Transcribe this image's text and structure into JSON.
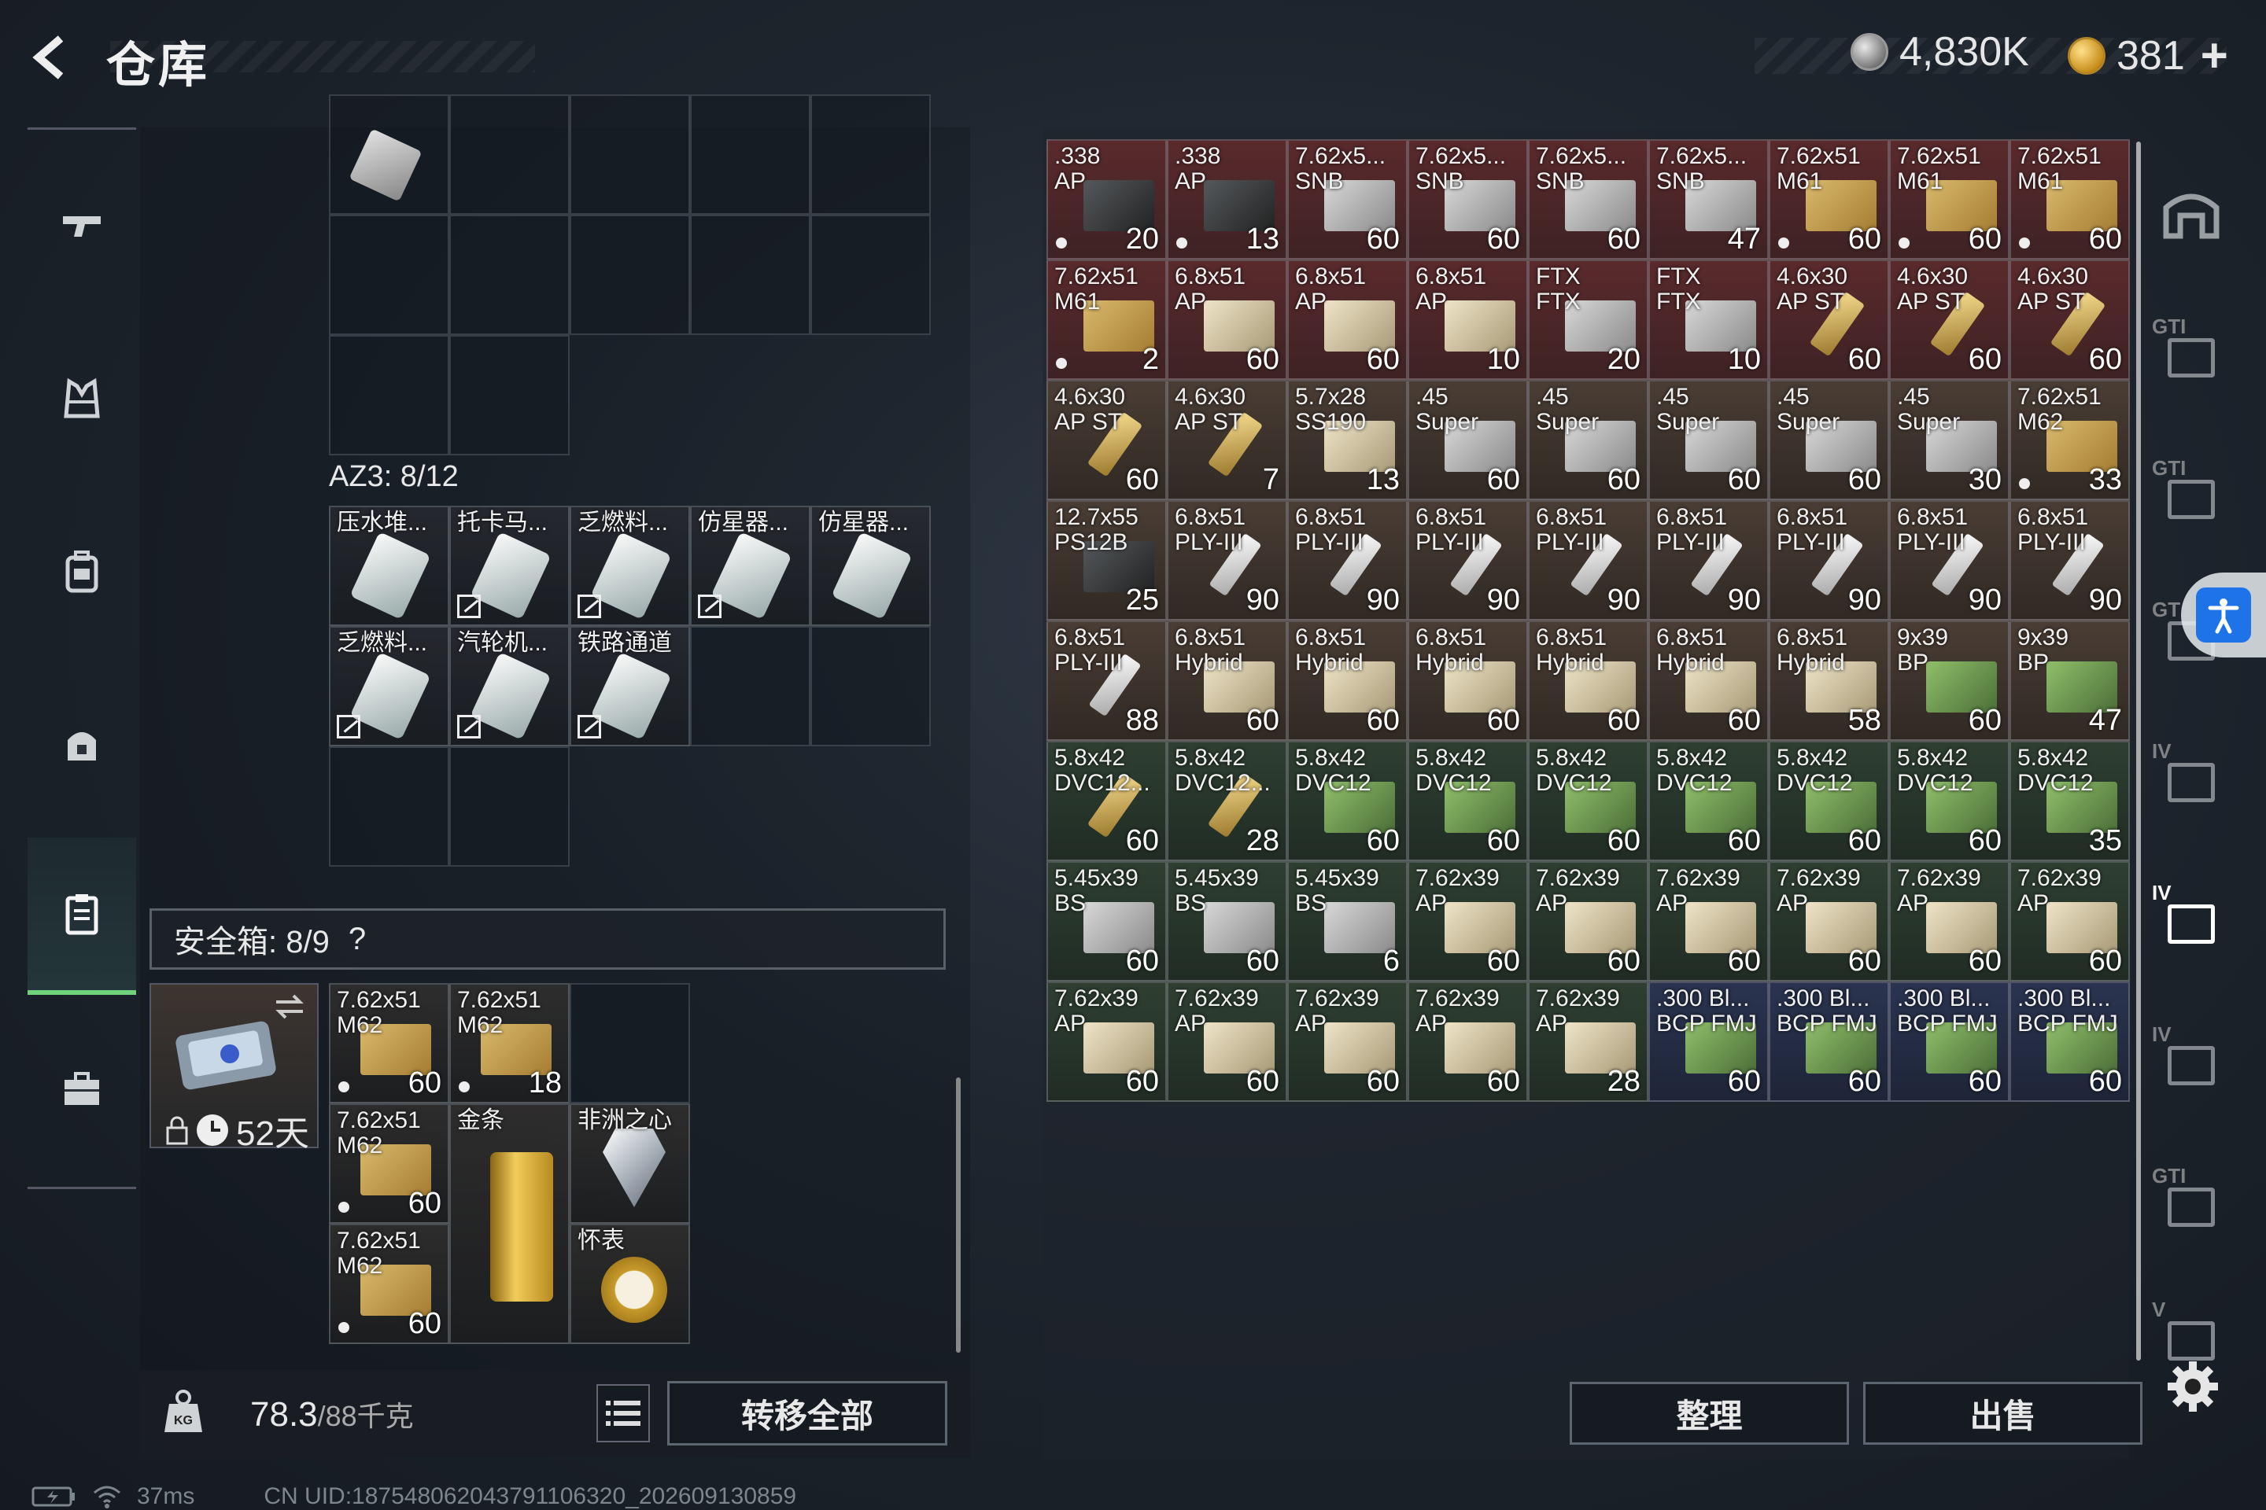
{
  "header": {
    "title": "仓库",
    "currency_silver": "4,830K",
    "currency_gold": "381",
    "plus": "+"
  },
  "az3": {
    "label": "AZ3: 8/12"
  },
  "az3_items": [
    {
      "label": "压水堆...",
      "flag": false
    },
    {
      "label": "托卡马...",
      "flag": true
    },
    {
      "label": "乏燃料...",
      "flag": true
    },
    {
      "label": "仿星器...",
      "flag": true
    },
    {
      "label": "仿星器...",
      "flag": false
    },
    {
      "label": "乏燃料...",
      "flag": true
    },
    {
      "label": "汽轮机...",
      "flag": true
    },
    {
      "label": "铁路通道",
      "flag": true
    }
  ],
  "safe": {
    "label": "安全箱: 8/9",
    "help": "?",
    "days": "52天"
  },
  "safe_items": [
    {
      "l1": "7.62x51",
      "l2": "M62",
      "count": "60"
    },
    {
      "l1": "7.62x51",
      "l2": "M62",
      "count": "18"
    },
    {
      "l1": "7.62x51",
      "l2": "M62",
      "count": "60"
    },
    {
      "l1": "金条",
      "l2": "",
      "count": ""
    },
    {
      "l1": "非洲之心",
      "l2": "",
      "count": ""
    },
    {
      "l1": "7.62x51",
      "l2": "M62",
      "count": "60"
    },
    {
      "l1": "怀表",
      "l2": "",
      "count": ""
    }
  ],
  "bottom": {
    "weight": "78.3",
    "weight_max": "/88千克",
    "transfer_all": "转移全部",
    "sort": "整理",
    "sell": "出售"
  },
  "status": {
    "ping": "37ms",
    "uid": "CN UID:1875480620437911063​20_202609130859"
  },
  "right_sidebar": [
    "GTI",
    "GTI",
    "GT",
    "IV",
    "IV",
    "IV",
    "GTI",
    "V"
  ],
  "ammo": [
    {
      "l1": ".338",
      "l2": "AP",
      "count": "20",
      "c": "red",
      "s": "sp-dark",
      "dot": true
    },
    {
      "l1": ".338",
      "l2": "AP",
      "count": "13",
      "c": "red",
      "s": "sp-dark",
      "dot": true
    },
    {
      "l1": "7.62x5...",
      "l2": "SNB",
      "count": "60",
      "c": "red",
      "s": "sp-silver",
      "dot": false
    },
    {
      "l1": "7.62x5...",
      "l2": "SNB",
      "count": "60",
      "c": "red",
      "s": "sp-silver",
      "dot": false
    },
    {
      "l1": "7.62x5...",
      "l2": "SNB",
      "count": "60",
      "c": "red",
      "s": "sp-silver",
      "dot": false
    },
    {
      "l1": "7.62x5...",
      "l2": "SNB",
      "count": "47",
      "c": "red",
      "s": "sp-silver",
      "dot": false
    },
    {
      "l1": "7.62x51",
      "l2": "M61",
      "count": "60",
      "c": "red",
      "s": "sp-box",
      "dot": true
    },
    {
      "l1": "7.62x51",
      "l2": "M61",
      "count": "60",
      "c": "red",
      "s": "sp-box",
      "dot": true
    },
    {
      "l1": "7.62x51",
      "l2": "M61",
      "count": "60",
      "c": "red",
      "s": "sp-box",
      "dot": true
    },
    {
      "l1": "7.62x51",
      "l2": "M61",
      "count": "2",
      "c": "red",
      "s": "sp-box",
      "dot": true
    },
    {
      "l1": "6.8x51",
      "l2": "AP",
      "count": "60",
      "c": "red",
      "s": "sp-cream",
      "dot": false
    },
    {
      "l1": "6.8x51",
      "l2": "AP",
      "count": "60",
      "c": "red",
      "s": "sp-cream",
      "dot": false
    },
    {
      "l1": "6.8x51",
      "l2": "AP",
      "count": "10",
      "c": "red",
      "s": "sp-cream",
      "dot": false
    },
    {
      "l1": "FTX",
      "l2": "FTX",
      "count": "20",
      "c": "red",
      "s": "sp-silver",
      "dot": false
    },
    {
      "l1": "FTX",
      "l2": "FTX",
      "count": "10",
      "c": "red",
      "s": "sp-silver",
      "dot": false
    },
    {
      "l1": "4.6x30",
      "l2": "AP ST",
      "count": "60",
      "c": "red",
      "s": "sp-bullet",
      "dot": false
    },
    {
      "l1": "4.6x30",
      "l2": "AP ST",
      "count": "60",
      "c": "red",
      "s": "sp-bullet",
      "dot": false
    },
    {
      "l1": "4.6x30",
      "l2": "AP ST",
      "count": "60",
      "c": "red",
      "s": "sp-bullet",
      "dot": false
    },
    {
      "l1": "4.6x30",
      "l2": "AP ST",
      "count": "60",
      "c": "brown",
      "s": "sp-bullet",
      "dot": false
    },
    {
      "l1": "4.6x30",
      "l2": "AP ST",
      "count": "7",
      "c": "brown",
      "s": "sp-bullet",
      "dot": false
    },
    {
      "l1": "5.7x28",
      "l2": "SS190",
      "count": "13",
      "c": "brown",
      "s": "sp-cream",
      "dot": false
    },
    {
      "l1": ".45",
      "l2": "Super",
      "count": "60",
      "c": "brown",
      "s": "sp-silver",
      "dot": false
    },
    {
      "l1": ".45",
      "l2": "Super",
      "count": "60",
      "c": "brown",
      "s": "sp-silver",
      "dot": false
    },
    {
      "l1": ".45",
      "l2": "Super",
      "count": "60",
      "c": "brown",
      "s": "sp-silver",
      "dot": false
    },
    {
      "l1": ".45",
      "l2": "Super",
      "count": "60",
      "c": "brown",
      "s": "sp-silver",
      "dot": false
    },
    {
      "l1": ".45",
      "l2": "Super",
      "count": "30",
      "c": "brown",
      "s": "sp-silver",
      "dot": false
    },
    {
      "l1": "7.62x51",
      "l2": "M62",
      "count": "33",
      "c": "brown",
      "s": "sp-box",
      "dot": true
    },
    {
      "l1": "12.7x55",
      "l2": "PS12B",
      "count": "25",
      "c": "brown",
      "s": "sp-dark",
      "dot": false
    },
    {
      "l1": "6.8x51",
      "l2": "PLY-III",
      "count": "90",
      "c": "brown",
      "s": "sp-white",
      "dot": false
    },
    {
      "l1": "6.8x51",
      "l2": "PLY-III",
      "count": "90",
      "c": "brown",
      "s": "sp-white",
      "dot": false
    },
    {
      "l1": "6.8x51",
      "l2": "PLY-III",
      "count": "90",
      "c": "brown",
      "s": "sp-white",
      "dot": false
    },
    {
      "l1": "6.8x51",
      "l2": "PLY-III",
      "count": "90",
      "c": "brown",
      "s": "sp-white",
      "dot": false
    },
    {
      "l1": "6.8x51",
      "l2": "PLY-III",
      "count": "90",
      "c": "brown",
      "s": "sp-white",
      "dot": false
    },
    {
      "l1": "6.8x51",
      "l2": "PLY-III",
      "count": "90",
      "c": "brown",
      "s": "sp-white",
      "dot": false
    },
    {
      "l1": "6.8x51",
      "l2": "PLY-III",
      "count": "90",
      "c": "brown",
      "s": "sp-white",
      "dot": false
    },
    {
      "l1": "6.8x51",
      "l2": "PLY-III",
      "count": "90",
      "c": "brown",
      "s": "sp-white",
      "dot": false
    },
    {
      "l1": "6.8x51",
      "l2": "PLY-III",
      "count": "88",
      "c": "brown",
      "s": "sp-white",
      "dot": false
    },
    {
      "l1": "6.8x51",
      "l2": "Hybrid",
      "count": "60",
      "c": "brown",
      "s": "sp-cream",
      "dot": false
    },
    {
      "l1": "6.8x51",
      "l2": "Hybrid",
      "count": "60",
      "c": "brown",
      "s": "sp-cream",
      "dot": false
    },
    {
      "l1": "6.8x51",
      "l2": "Hybrid",
      "count": "60",
      "c": "brown",
      "s": "sp-cream",
      "dot": false
    },
    {
      "l1": "6.8x51",
      "l2": "Hybrid",
      "count": "60",
      "c": "brown",
      "s": "sp-cream",
      "dot": false
    },
    {
      "l1": "6.8x51",
      "l2": "Hybrid",
      "count": "60",
      "c": "brown",
      "s": "sp-cream",
      "dot": false
    },
    {
      "l1": "6.8x51",
      "l2": "Hybrid",
      "count": "58",
      "c": "brown",
      "s": "sp-cream",
      "dot": false
    },
    {
      "l1": "9x39",
      "l2": "BP",
      "count": "60",
      "c": "brown",
      "s": "sp-green",
      "dot": false
    },
    {
      "l1": "9x39",
      "l2": "BP",
      "count": "47",
      "c": "brown",
      "s": "sp-green",
      "dot": false
    },
    {
      "l1": "5.8x42",
      "l2": "DVC12...",
      "count": "60",
      "c": "green",
      "s": "sp-bullet",
      "dot": false
    },
    {
      "l1": "5.8x42",
      "l2": "DVC12...",
      "count": "28",
      "c": "green",
      "s": "sp-bullet",
      "dot": false
    },
    {
      "l1": "5.8x42",
      "l2": "DVC12",
      "count": "60",
      "c": "green",
      "s": "sp-green",
      "dot": false
    },
    {
      "l1": "5.8x42",
      "l2": "DVC12",
      "count": "60",
      "c": "green",
      "s": "sp-green",
      "dot": false
    },
    {
      "l1": "5.8x42",
      "l2": "DVC12",
      "count": "60",
      "c": "green",
      "s": "sp-green",
      "dot": false
    },
    {
      "l1": "5.8x42",
      "l2": "DVC12",
      "count": "60",
      "c": "green",
      "s": "sp-green",
      "dot": false
    },
    {
      "l1": "5.8x42",
      "l2": "DVC12",
      "count": "60",
      "c": "green",
      "s": "sp-green",
      "dot": false
    },
    {
      "l1": "5.8x42",
      "l2": "DVC12",
      "count": "60",
      "c": "green",
      "s": "sp-green",
      "dot": false
    },
    {
      "l1": "5.8x42",
      "l2": "DVC12",
      "count": "35",
      "c": "green",
      "s": "sp-green",
      "dot": false
    },
    {
      "l1": "5.45x39",
      "l2": "BS",
      "count": "60",
      "c": "green",
      "s": "sp-silver",
      "dot": false
    },
    {
      "l1": "5.45x39",
      "l2": "BS",
      "count": "60",
      "c": "green",
      "s": "sp-silver",
      "dot": false
    },
    {
      "l1": "5.45x39",
      "l2": "BS",
      "count": "6",
      "c": "green",
      "s": "sp-silver",
      "dot": false
    },
    {
      "l1": "7.62x39",
      "l2": "AP",
      "count": "60",
      "c": "green",
      "s": "sp-cream",
      "dot": false
    },
    {
      "l1": "7.62x39",
      "l2": "AP",
      "count": "60",
      "c": "green",
      "s": "sp-cream",
      "dot": false
    },
    {
      "l1": "7.62x39",
      "l2": "AP",
      "count": "60",
      "c": "green",
      "s": "sp-cream",
      "dot": false
    },
    {
      "l1": "7.62x39",
      "l2": "AP",
      "count": "60",
      "c": "green",
      "s": "sp-cream",
      "dot": false
    },
    {
      "l1": "7.62x39",
      "l2": "AP",
      "count": "60",
      "c": "green",
      "s": "sp-cream",
      "dot": false
    },
    {
      "l1": "7.62x39",
      "l2": "AP",
      "count": "60",
      "c": "green",
      "s": "sp-cream",
      "dot": false
    },
    {
      "l1": "7.62x39",
      "l2": "AP",
      "count": "60",
      "c": "green",
      "s": "sp-cream",
      "dot": false
    },
    {
      "l1": "7.62x39",
      "l2": "AP",
      "count": "60",
      "c": "green",
      "s": "sp-cream",
      "dot": false
    },
    {
      "l1": "7.62x39",
      "l2": "AP",
      "count": "60",
      "c": "green",
      "s": "sp-cream",
      "dot": false
    },
    {
      "l1": "7.62x39",
      "l2": "AP",
      "count": "60",
      "c": "green",
      "s": "sp-cream",
      "dot": false
    },
    {
      "l1": "7.62x39",
      "l2": "AP",
      "count": "28",
      "c": "green",
      "s": "sp-cream",
      "dot": false
    },
    {
      "l1": ".300 Bl...",
      "l2": "BCP FMJ",
      "count": "60",
      "c": "blue",
      "s": "sp-green",
      "dot": false
    },
    {
      "l1": ".300 Bl...",
      "l2": "BCP FMJ",
      "count": "60",
      "c": "blue",
      "s": "sp-green",
      "dot": false
    },
    {
      "l1": ".300 Bl...",
      "l2": "BCP FMJ",
      "count": "60",
      "c": "blue",
      "s": "sp-green",
      "dot": false
    },
    {
      "l1": ".300 Bl...",
      "l2": "BCP FMJ",
      "count": "60",
      "c": "blue",
      "s": "sp-green",
      "dot": false
    }
  ]
}
